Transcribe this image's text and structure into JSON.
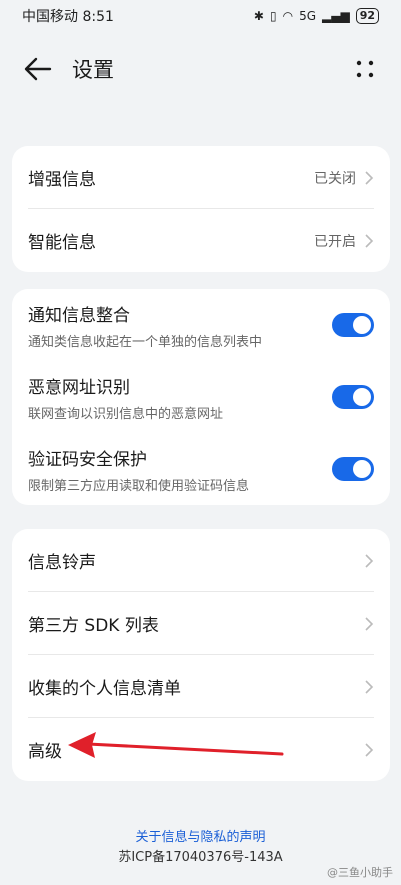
{
  "status_bar": {
    "carrier_time": "中国移动 8:51",
    "signal_text": "5G",
    "battery": "92"
  },
  "app_bar": {
    "title": "设置"
  },
  "card1": {
    "items": [
      {
        "label": "增强信息",
        "value": "已关闭"
      },
      {
        "label": "智能信息",
        "value": "已开启"
      }
    ]
  },
  "card2": {
    "items": [
      {
        "label": "通知信息整合",
        "sub": "通知类信息收起在一个单独的信息列表中",
        "on": true
      },
      {
        "label": "恶意网址识别",
        "sub": "联网查询以识别信息中的恶意网址",
        "on": true
      },
      {
        "label": "验证码安全保护",
        "sub": "限制第三方应用读取和使用验证码信息",
        "on": true
      }
    ]
  },
  "card3": {
    "items": [
      {
        "label": "信息铃声"
      },
      {
        "label": "第三方 SDK 列表"
      },
      {
        "label": "收集的个人信息清单"
      },
      {
        "label": "高级"
      }
    ]
  },
  "footer": {
    "link": "关于信息与隐私的声明",
    "icp": "苏ICP备17040376号-143A",
    "watermark": "@三鱼小助手"
  },
  "colors": {
    "accent": "#1869e8",
    "annotation_arrow": "#e0202a",
    "link": "#1a5fd6"
  }
}
